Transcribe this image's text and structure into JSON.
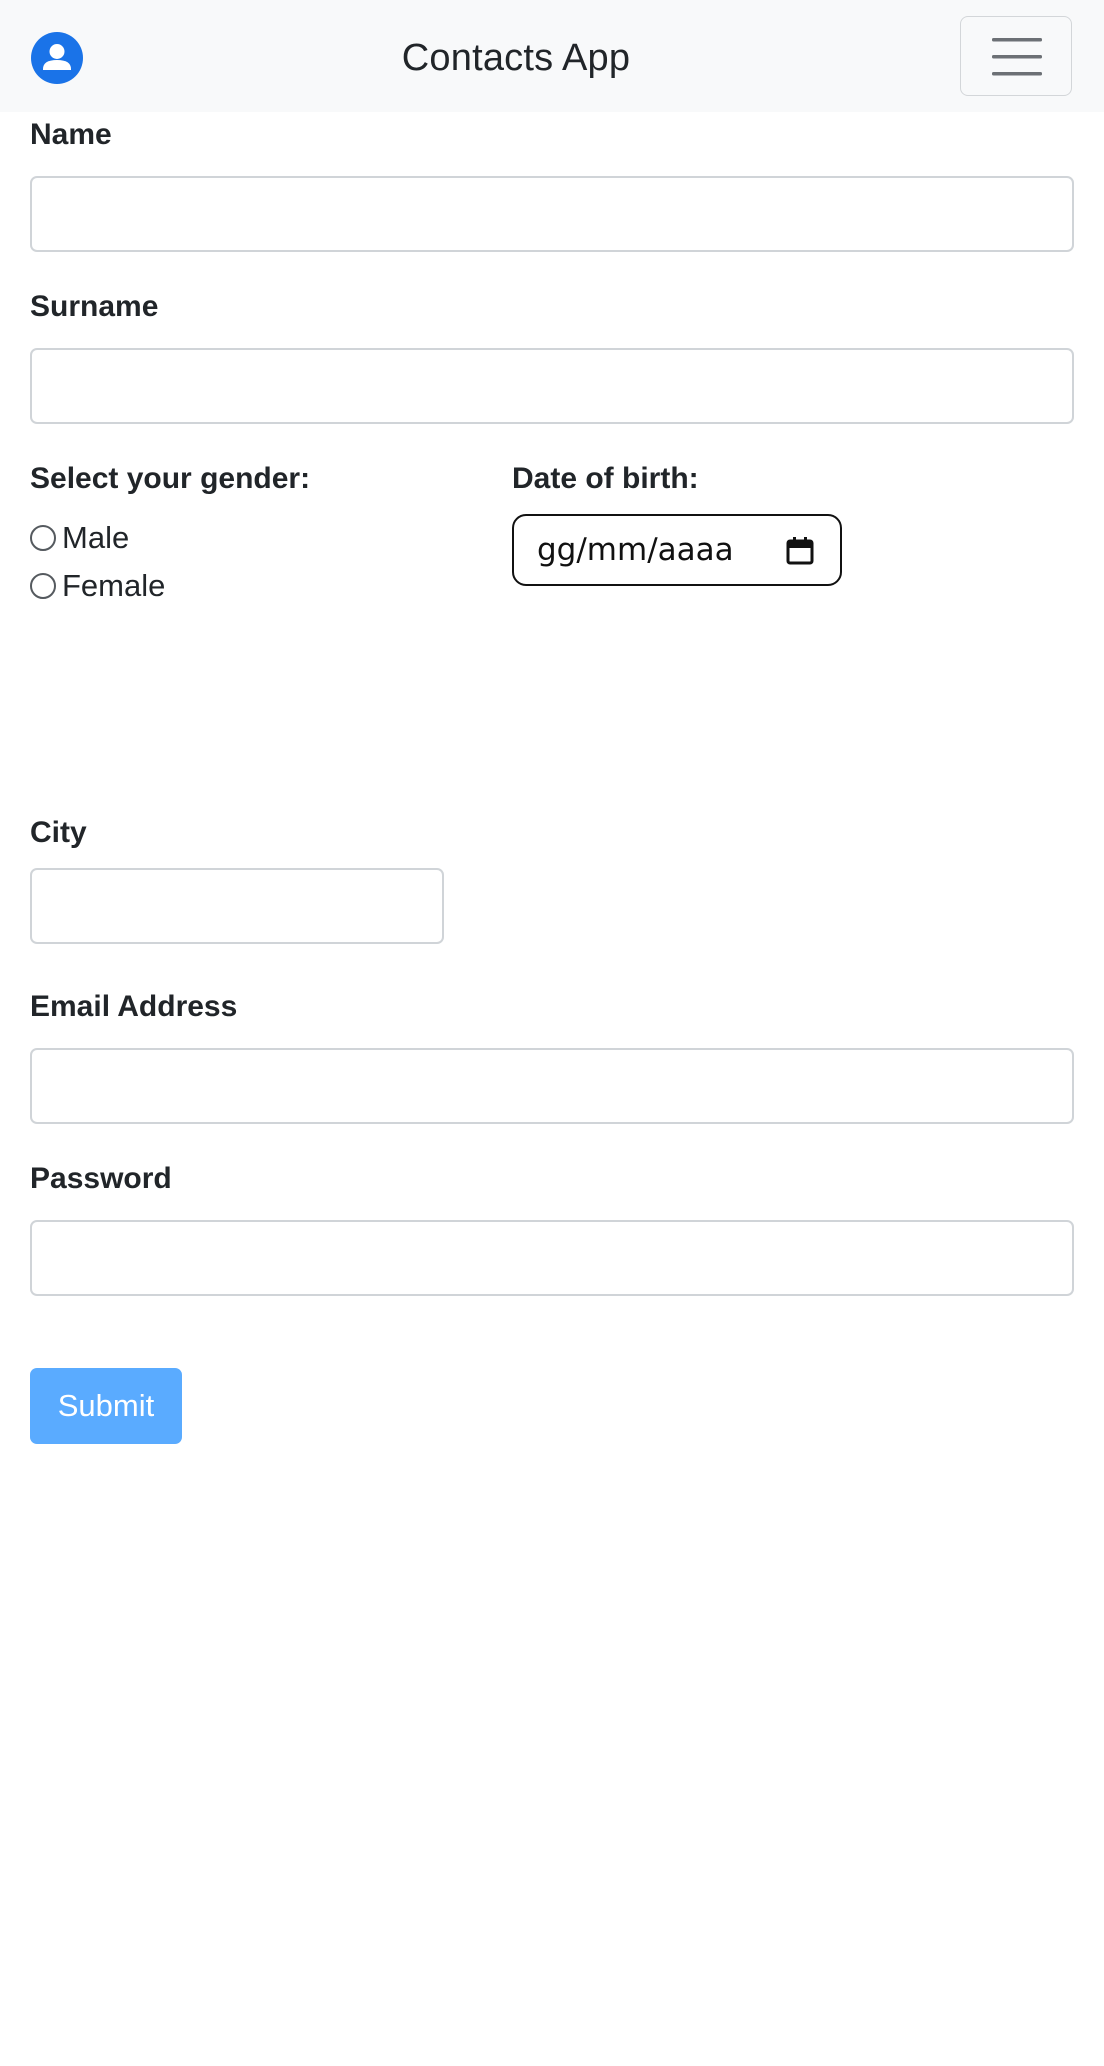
{
  "header": {
    "title": "Contacts App",
    "avatar_icon": "user-circle-icon",
    "menu_icon": "hamburger-menu-icon"
  },
  "form": {
    "name": {
      "label": "Name",
      "value": ""
    },
    "surname": {
      "label": "Surname",
      "value": ""
    },
    "gender": {
      "label": "Select your gender:",
      "options": [
        "Male",
        "Female"
      ],
      "selected": null
    },
    "dob": {
      "label": "Date of birth:",
      "placeholder": "gg/mm/aaaa",
      "icon": "calendar-icon"
    },
    "city": {
      "label": "City",
      "value": ""
    },
    "email": {
      "label": "Email Address",
      "value": ""
    },
    "password": {
      "label": "Password",
      "value": ""
    },
    "submit_label": "Submit"
  },
  "colors": {
    "navbar_bg": "#f8f9fa",
    "avatar": "#1a73e8",
    "submit_bg": "#5aabff",
    "text": "#212529"
  }
}
